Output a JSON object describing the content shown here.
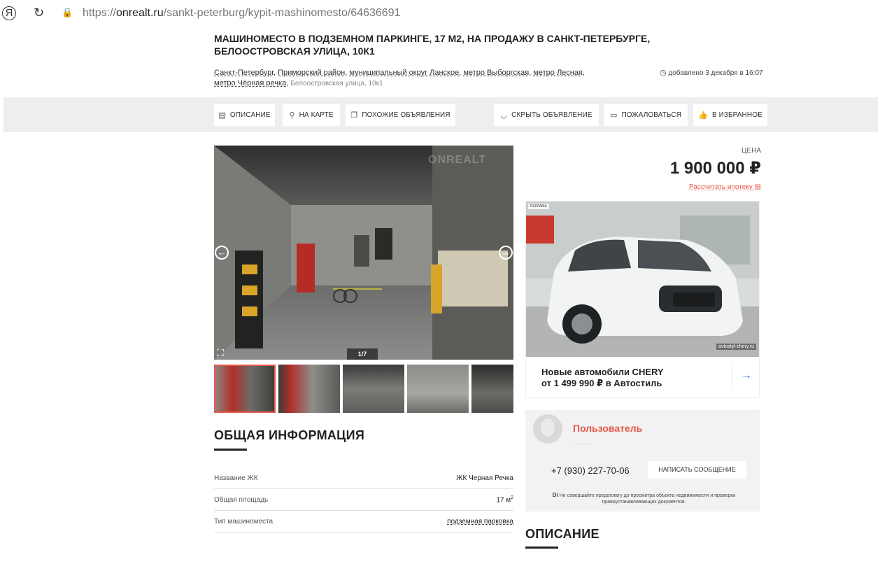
{
  "browser": {
    "yandex_glyph": "Я",
    "reload_glyph": "↻",
    "lock_glyph": "🔒",
    "url_proto": "https://",
    "url_domain": "onrealt.ru",
    "url_path": "/sankt-peterburg/kypit-mashinomesto/64636691"
  },
  "listing": {
    "title": "Машиноместо в подземном паркинге, 17 м2, на продажу в Санкт-Петербурге, Белоостровская улица, 10к1",
    "address": {
      "city": "Санкт-Петербург",
      "district": "Приморский район",
      "municipal": "муниципальный округ Ланское",
      "metro1": "метро Выборгская",
      "metro2": "метро Лесная",
      "metro3": "метро Чёрная речка",
      "street": "Белоостровская улица, 10к1",
      "sep": ",",
      "sep_sp": ", "
    },
    "added": "добавлено 3 декабря в 16:07"
  },
  "nav": {
    "description": "Описание",
    "on_map": "На карте",
    "similar": "Похожие объявления",
    "hide": "Скрыть объявление",
    "complain": "Пожаловаться",
    "favorite": "В избранное"
  },
  "gallery": {
    "counter": "1/7",
    "watermark": "ONREALT",
    "expand_glyph": "⛶",
    "prev_glyph": "←",
    "next_glyph": "→"
  },
  "info": {
    "title": "Общая информация",
    "rows": [
      {
        "label": "Название ЖК",
        "value": "ЖК Черная Речка"
      },
      {
        "label": "Общая площадь",
        "value": "17 м",
        "sup": "2"
      },
      {
        "label": "Тип машиноместа",
        "value": "подземная парковка"
      }
    ]
  },
  "price": {
    "label": "Цена",
    "value": "1 900 000 ₽",
    "mortgage": "Рассчитать ипотеку"
  },
  "ad": {
    "tag": "РЕКЛАМА",
    "source": "avtostyl-chery.ru",
    "line1": "Новые автомобили CHERY",
    "line2": "от 1 499 990 ₽ в Автостиль"
  },
  "contact": {
    "name": "Пользователь",
    "phone": "+7 (930) 227-70-06",
    "message_btn": "Написать сообщение",
    "warning": "Не совершайте предоплату до просмотра объекта недвижимости и проверки правоустанавливающих документов."
  },
  "description": {
    "title": "Описание"
  },
  "colors": {
    "accent": "#e8584b",
    "link_blue": "#2a6fd6",
    "strip": "#eeeeee"
  }
}
